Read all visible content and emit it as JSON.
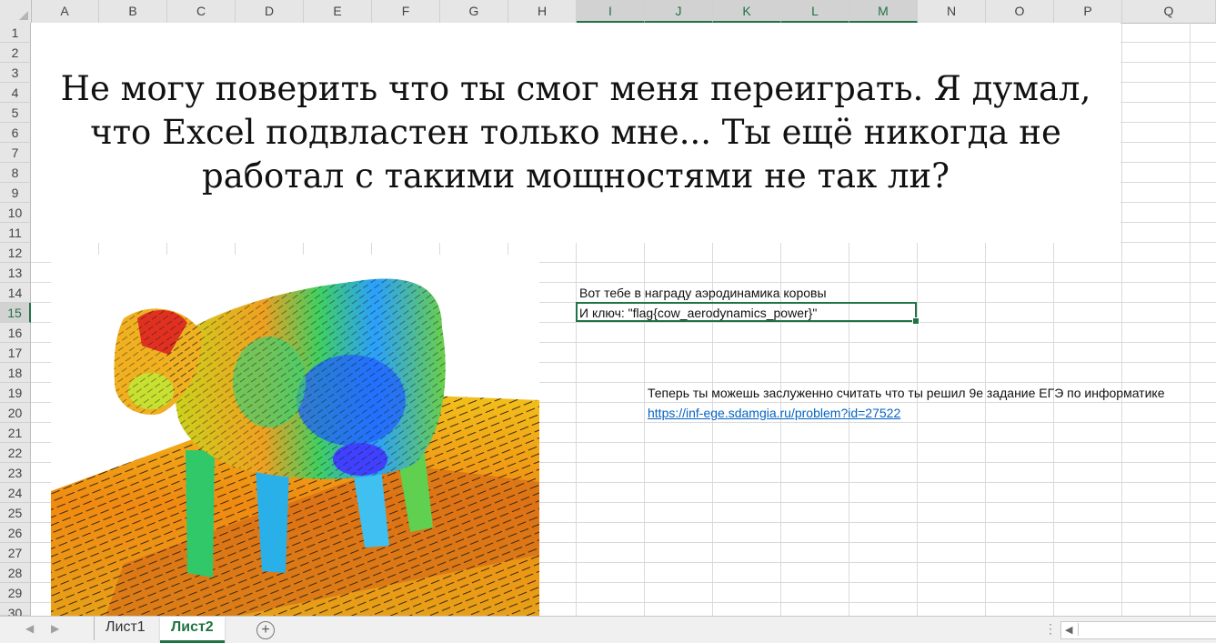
{
  "columns": [
    "A",
    "B",
    "C",
    "D",
    "E",
    "F",
    "G",
    "H",
    "I",
    "J",
    "K",
    "L",
    "M",
    "N",
    "O",
    "P",
    "Q"
  ],
  "selected_columns": [
    "I",
    "J",
    "K",
    "L",
    "M"
  ],
  "rows": [
    "1",
    "2",
    "3",
    "4",
    "5",
    "6",
    "7",
    "8",
    "9",
    "10",
    "11",
    "12",
    "13",
    "14",
    "15",
    "16",
    "17",
    "18",
    "19",
    "20",
    "21",
    "22",
    "23",
    "24",
    "25",
    "26",
    "27",
    "28",
    "29",
    "30"
  ],
  "selected_row": "15",
  "title_text": "Не могу поверить что ты смог меня переиграть. Я думал, что Excel подвластен только мне... Ты ещё никогда не работал с такими мощностями не так ли?",
  "cells": {
    "i14": "Вот тебе в награду аэродинамика коровы",
    "i15": "И ключ: \"flag{cow_aerodynamics_power}\"",
    "j19": "Теперь ты можешь заслуженно считать что ты решил 9е задание ЕГЭ по информатике",
    "j20": "https://inf-ege.sdamgia.ru/problem?id=27522"
  },
  "sheets": {
    "tab1": "Лист1",
    "tab2": "Лист2",
    "active": "Лист2"
  },
  "colors": {
    "excel_green": "#217346",
    "link_blue": "#0563c1"
  },
  "image": {
    "subject": "cow aerodynamics CFD visualization"
  }
}
